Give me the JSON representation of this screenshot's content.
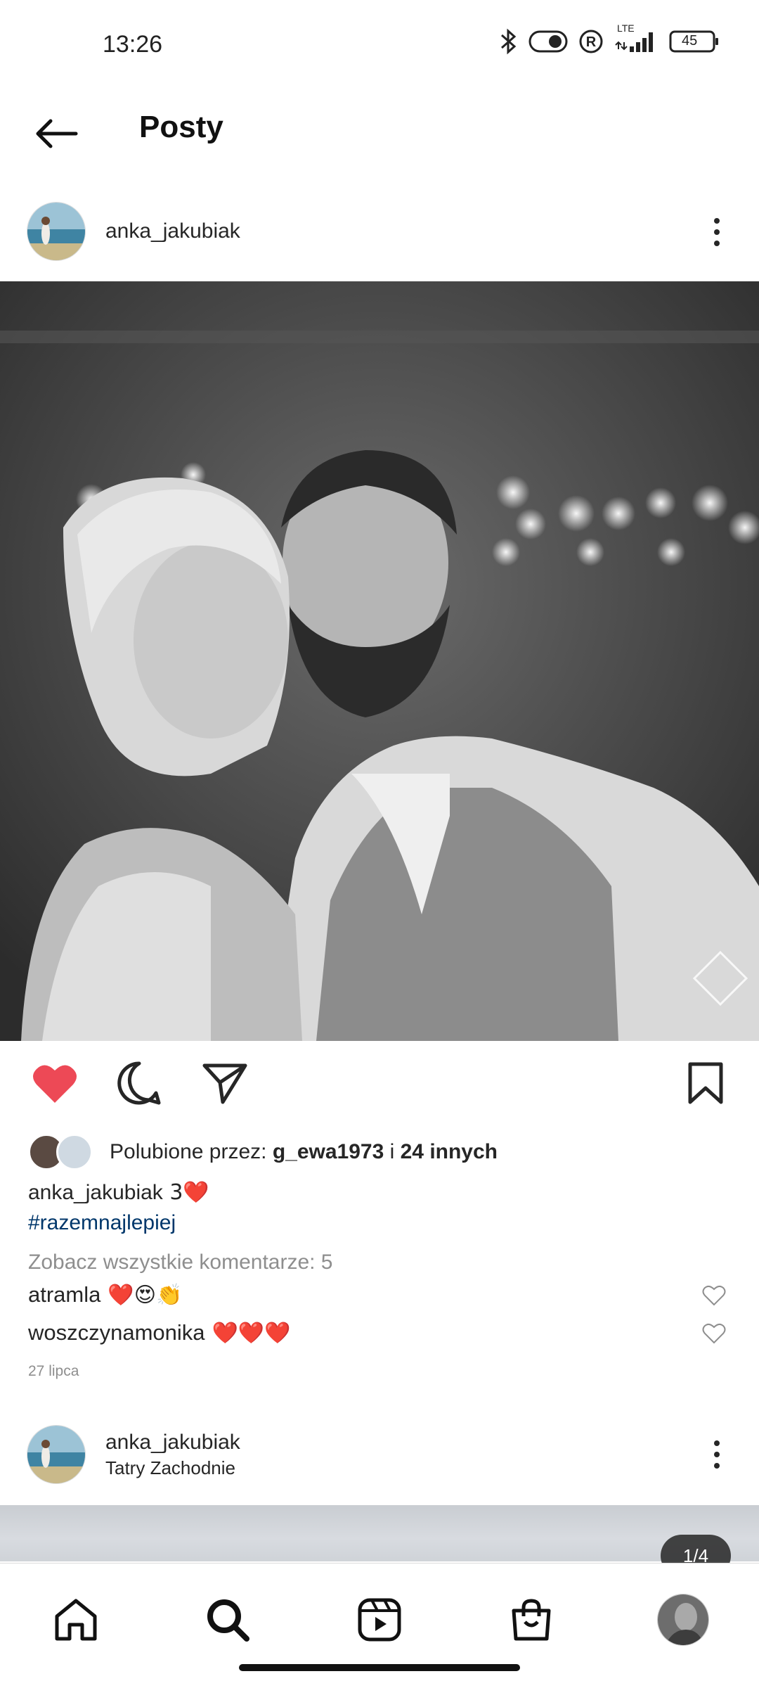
{
  "status": {
    "time": "13:26",
    "network": "LTE",
    "battery": "45"
  },
  "header": {
    "title": "Posty"
  },
  "post1": {
    "username": "anka_jakubiak",
    "likes": {
      "prefix": "Polubione przez: ",
      "user": "g_ewa1973",
      "joiner": " i ",
      "others": "24 innych"
    },
    "caption": {
      "user": "anka_jakubiak",
      "text": " 3❤️"
    },
    "hashtag": "#razemnajlepiej",
    "view_comments": "Zobacz wszystkie komentarze: 5",
    "comments": [
      {
        "user": "atramla",
        "text": "❤️😍👏"
      },
      {
        "user": "woszczynamonika",
        "text": "❤️❤️❤️"
      }
    ],
    "date": "27 lipca",
    "liked": true
  },
  "post2": {
    "username": "anka_jakubiak",
    "location": "Tatry Zachodnie",
    "counter": "1/4"
  },
  "colors": {
    "like_red": "#ed4956",
    "hashtag_blue": "#00376b",
    "muted_gray": "#8e8e8e"
  },
  "icons": [
    "back-arrow-icon",
    "more-vert-icon",
    "heart-filled-icon",
    "comment-icon",
    "share-icon",
    "bookmark-icon",
    "home-icon",
    "search-icon",
    "reels-icon",
    "shop-icon"
  ]
}
